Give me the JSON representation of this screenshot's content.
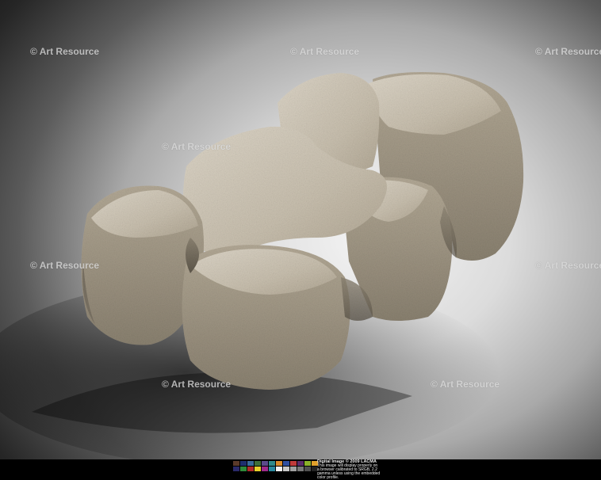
{
  "watermark_text": "© Art Resource",
  "credit": {
    "title": "Digital Image © 2009 LACMA",
    "body": "This image will display properly on a browser calibrated to SRGB, 2.2 gamma unless using the embedded color profile."
  },
  "swatch_colors": [
    [
      "#5a3a2a",
      "#1e2f6e",
      "#3b6a9a",
      "#3f6f3a",
      "#5b4a8a",
      "#2f8a8a",
      "#d88a2a",
      "#2f4fa0",
      "#c03a3a",
      "#5a2a6a",
      "#8ab02a",
      "#e0a02a"
    ],
    [
      "#2a2a6a",
      "#2f8a3a",
      "#b02a2a",
      "#e8d02a",
      "#a02a8a",
      "#2a8aa0",
      "#f2f2f2",
      "#c8c8c8",
      "#a0a0a0",
      "#787878",
      "#505050",
      "#222222"
    ]
  ],
  "colors": {
    "stone_light": "#d9d1c2",
    "stone_mid": "#b5ab99",
    "stone_dark": "#6e665a"
  }
}
